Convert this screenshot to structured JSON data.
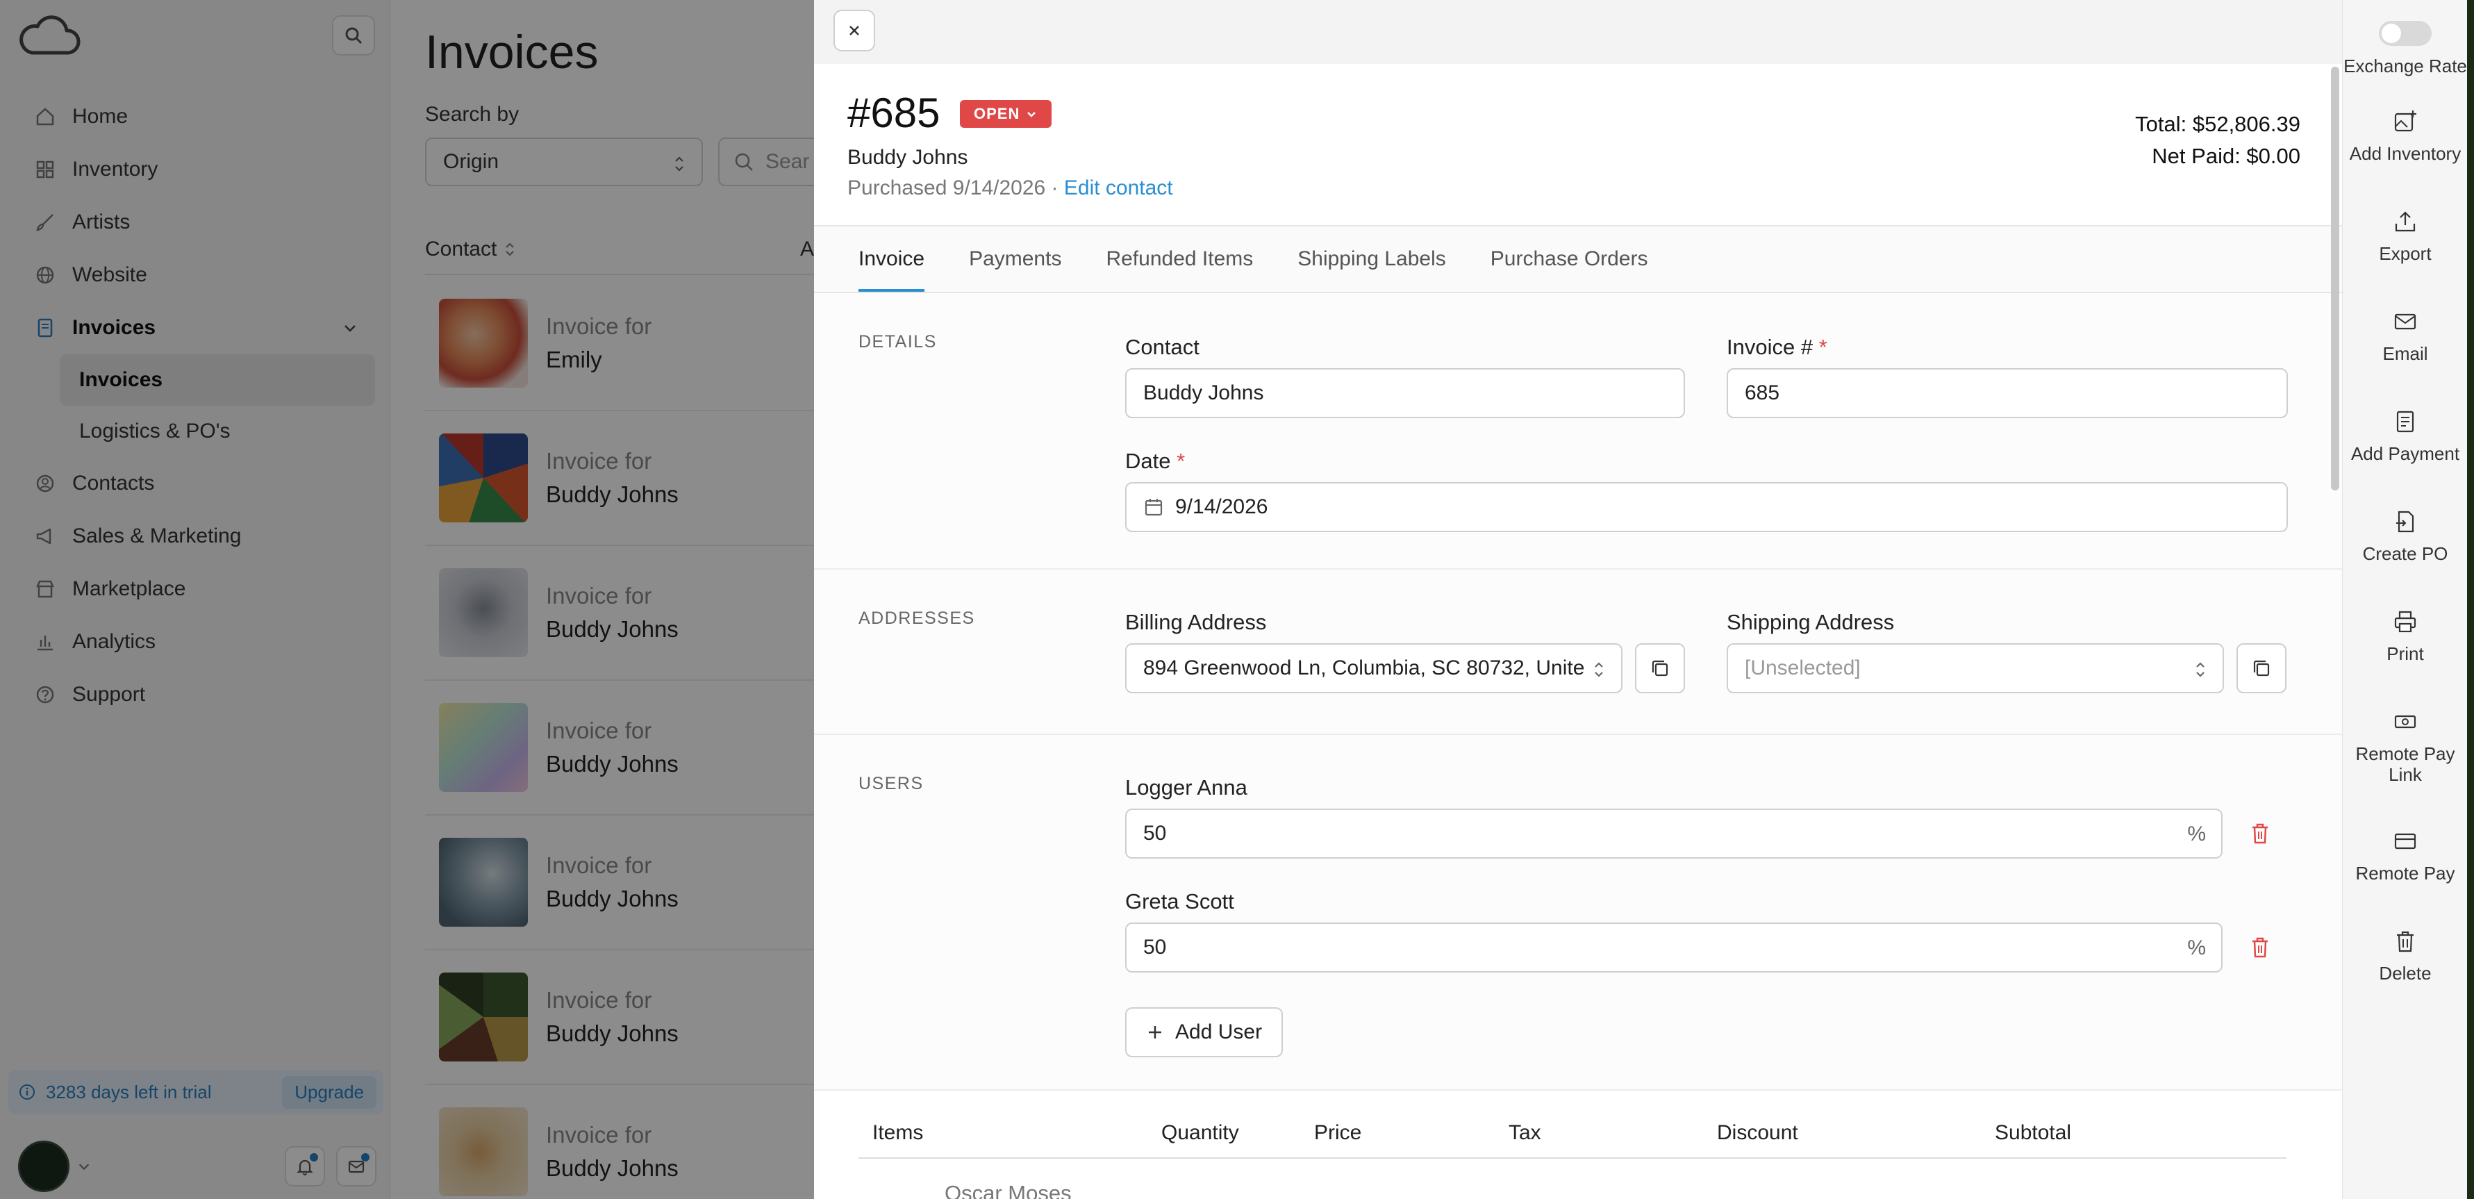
{
  "sidebar": {
    "nav": [
      {
        "label": "Home",
        "icon": "home-icon"
      },
      {
        "label": "Inventory",
        "icon": "grid-icon"
      },
      {
        "label": "Artists",
        "icon": "brush-icon"
      },
      {
        "label": "Website",
        "icon": "globe-icon"
      },
      {
        "label": "Invoices",
        "icon": "document-icon"
      }
    ],
    "invoices_sub": [
      "Invoices",
      "Logistics & PO's"
    ],
    "nav_after": [
      {
        "label": "Contacts",
        "icon": "person-icon"
      },
      {
        "label": "Sales & Marketing",
        "icon": "megaphone-icon"
      },
      {
        "label": "Marketplace",
        "icon": "store-icon"
      },
      {
        "label": "Analytics",
        "icon": "chart-icon"
      },
      {
        "label": "Support",
        "icon": "help-icon"
      }
    ],
    "trial_text": "3283 days left in trial",
    "upgrade_label": "Upgrade"
  },
  "list": {
    "title": "Invoices",
    "search_by_label": "Search by",
    "search_by_value": "Origin",
    "search_placeholder": "Sear",
    "column_contact": "Contact",
    "column_b": "A",
    "rows": [
      {
        "l1": "Invoice for",
        "l2": "Emily"
      },
      {
        "l1": "Invoice for",
        "l2": "Buddy Johns"
      },
      {
        "l1": "Invoice for",
        "l2": "Buddy Johns"
      },
      {
        "l1": "Invoice for",
        "l2": "Buddy Johns"
      },
      {
        "l1": "Invoice for",
        "l2": "Buddy Johns"
      },
      {
        "l1": "Invoice for",
        "l2": "Buddy Johns"
      },
      {
        "l1": "Invoice for",
        "l2": "Buddy Johns"
      }
    ]
  },
  "invoice": {
    "number": "#685",
    "status": "OPEN",
    "customer": "Buddy Johns",
    "purchased": "Purchased 9/14/2026 · ",
    "edit_contact": "Edit contact",
    "total": "Total: $52,806.39",
    "net_paid": "Net Paid: $0.00",
    "tabs": [
      "Invoice",
      "Payments",
      "Refunded Items",
      "Shipping Labels",
      "Purchase Orders"
    ],
    "details": {
      "section": "DETAILS",
      "contact_label": "Contact",
      "contact_value": "Buddy Johns",
      "invoice_label": "Invoice #",
      "invoice_value": "685",
      "date_label": "Date",
      "date_value": "9/14/2026",
      "required_mark": "*"
    },
    "addresses": {
      "section": "ADDRESSES",
      "billing_label": "Billing Address",
      "billing_value": "894 Greenwood Ln, Columbia, SC 80732, Unite",
      "shipping_label": "Shipping Address",
      "shipping_value": "[Unselected]"
    },
    "users": {
      "section": "USERS",
      "list": [
        {
          "name": "Logger Anna",
          "value": "50"
        },
        {
          "name": "Greta Scott",
          "value": "50"
        }
      ],
      "percent": "%",
      "add_label": "Add User"
    },
    "items": {
      "columns": [
        "Items",
        "Quantity",
        "Price",
        "Tax",
        "Discount",
        "Subtotal"
      ],
      "first_item": "Oscar Moses"
    }
  },
  "actions": [
    {
      "label": "Exchange Rate",
      "icon": "toggle-switch"
    },
    {
      "label": "Add Inventory",
      "icon": "add-image-icon"
    },
    {
      "label": "Export",
      "icon": "upload-icon"
    },
    {
      "label": "Email",
      "icon": "mail-icon"
    },
    {
      "label": "Add Payment",
      "icon": "receipt-icon"
    },
    {
      "label": "Create PO",
      "icon": "file-export-icon"
    },
    {
      "label": "Print",
      "icon": "printer-icon"
    },
    {
      "label": "Remote Pay Link",
      "icon": "cash-icon"
    },
    {
      "label": "Remote Pay",
      "icon": "card-icon"
    },
    {
      "label": "Delete",
      "icon": "trash-icon"
    }
  ],
  "colors": {
    "accent": "#2a8fd0",
    "danger": "#e04848",
    "overlay": "rgba(0,0,0,0.45)"
  }
}
